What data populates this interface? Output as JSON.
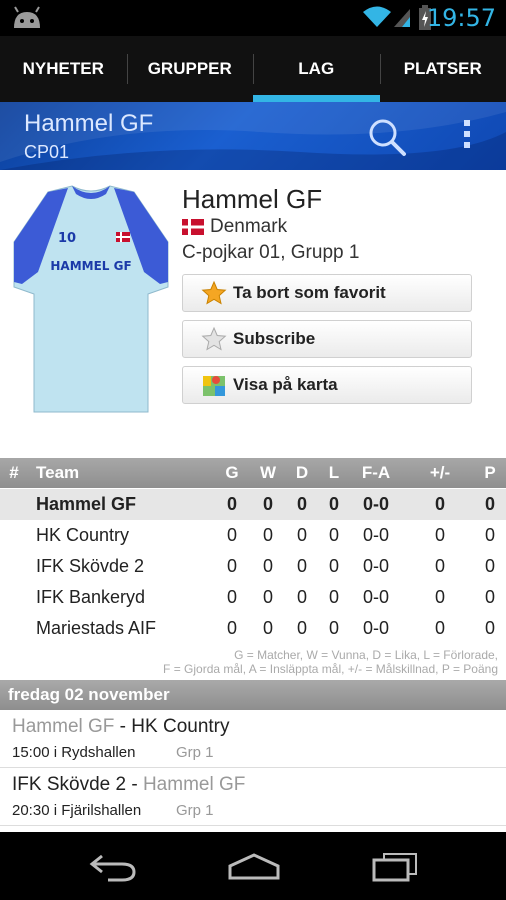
{
  "status_bar": {
    "time": "19:57"
  },
  "tabs": [
    {
      "label": "NYHETER",
      "active": false
    },
    {
      "label": "GRUPPER",
      "active": false
    },
    {
      "label": "LAG",
      "active": true
    },
    {
      "label": "PLATSER",
      "active": false
    }
  ],
  "header": {
    "title": "Hammel GF",
    "subtitle": "CP01"
  },
  "team": {
    "shirt_number": "10",
    "shirt_text": "HAMMEL GF",
    "name": "Hammel GF",
    "country": "Denmark",
    "group": "C-pojkar 01, Grupp 1",
    "buttons": {
      "favorite": "Ta bort som favorit",
      "subscribe": "Subscribe",
      "map": "Visa på karta"
    }
  },
  "table": {
    "headers": {
      "num": "#",
      "team": "Team",
      "g": "G",
      "w": "W",
      "d": "D",
      "l": "L",
      "fa": "F-A",
      "pm": "+/-",
      "p": "P"
    },
    "rows": [
      {
        "team": "Hammel GF",
        "g": "0",
        "w": "0",
        "d": "0",
        "l": "0",
        "fa": "0-0",
        "pm": "0",
        "p": "0"
      },
      {
        "team": "HK Country",
        "g": "0",
        "w": "0",
        "d": "0",
        "l": "0",
        "fa": "0-0",
        "pm": "0",
        "p": "0"
      },
      {
        "team": "IFK Skövde 2",
        "g": "0",
        "w": "0",
        "d": "0",
        "l": "0",
        "fa": "0-0",
        "pm": "0",
        "p": "0"
      },
      {
        "team": "IFK Bankeryd",
        "g": "0",
        "w": "0",
        "d": "0",
        "l": "0",
        "fa": "0-0",
        "pm": "0",
        "p": "0"
      },
      {
        "team": "Mariestads AIF",
        "g": "0",
        "w": "0",
        "d": "0",
        "l": "0",
        "fa": "0-0",
        "pm": "0",
        "p": "0"
      }
    ],
    "legend_line1": "G = Matcher, W = Vunna, D = Lika, L = Förlorade,",
    "legend_line2": "F = Gjorda mål, A = Insläppta mål, +/- = Målskillnad, P = Poäng"
  },
  "schedule": {
    "date": "fredag 02 november",
    "matches": [
      {
        "home": "Hammel GF",
        "separator": " - ",
        "away": "HK Country",
        "info": "15:00 i Rydshallen",
        "group": "Grp 1"
      },
      {
        "home": "IFK Skövde 2",
        "separator": " - ",
        "away": "Hammel GF",
        "info": "20:30 i Fjärilshallen",
        "group": "Grp 1"
      }
    ]
  },
  "colors": {
    "accent": "#33b5e5",
    "header_blue": "#1a5fd0",
    "star": "#f5a623"
  },
  "icons": [
    "android-icon",
    "wifi-icon",
    "signal-icon",
    "battery-icon",
    "search-icon",
    "overflow-menu-icon",
    "danish-flag-icon",
    "star-filled-icon",
    "star-outline-icon",
    "map-icon",
    "back-icon",
    "home-icon",
    "recents-icon"
  ]
}
